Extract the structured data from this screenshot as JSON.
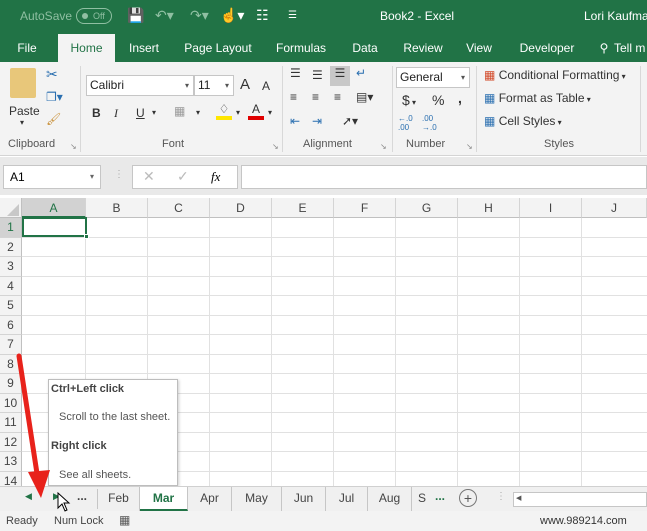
{
  "titlebar": {
    "autosave_label": "AutoSave",
    "autosave_state": "Off",
    "document_title": "Book2  -  Excel",
    "user_name": "Lori Kaufman"
  },
  "ribbon_tabs": [
    "File",
    "Home",
    "Insert",
    "Page Layout",
    "Formulas",
    "Data",
    "Review",
    "View",
    "Developer",
    "Tell m"
  ],
  "active_tab": "Home",
  "ribbon": {
    "clipboard": {
      "label": "Clipboard",
      "paste_label": "Paste"
    },
    "font": {
      "label": "Font",
      "font_name": "Calibri",
      "font_size": "11",
      "bold": "B",
      "italic": "I",
      "underline": "U",
      "grow": "A",
      "shrink": "A",
      "font_color_glyph": "A"
    },
    "alignment": {
      "label": "Alignment"
    },
    "number": {
      "label": "Number",
      "format": "General",
      "currency": "$",
      "percent": "%",
      "comma": ",",
      "inc_decimal": "←.0 .00",
      "dec_decimal": ".00 →.0"
    },
    "styles": {
      "label": "Styles",
      "conditional_formatting": "Conditional Formatting",
      "format_as_table": "Format as Table",
      "cell_styles": "Cell Styles"
    }
  },
  "formula_bar": {
    "name_box": "A1",
    "fx": "fx",
    "value": ""
  },
  "columns": [
    "A",
    "B",
    "C",
    "D",
    "E",
    "F",
    "G",
    "H",
    "I",
    "J"
  ],
  "rows": [
    "1",
    "2",
    "3",
    "4",
    "5",
    "6",
    "7",
    "8",
    "9",
    "10",
    "11",
    "12",
    "13",
    "14"
  ],
  "selected_cell": "A1",
  "tooltip": {
    "heading1": "Ctrl+Left click",
    "body1": "Scroll to the last sheet.",
    "heading2": "Right click",
    "body2": "See all sheets."
  },
  "sheet_tabs": [
    "Feb",
    "Mar",
    "Apr",
    "May",
    "Jun",
    "Jul",
    "Aug",
    "S"
  ],
  "active_sheet": "Mar",
  "sheet_nav": {
    "ellipsis_left": "...",
    "ellipsis_right": "...",
    "add_sheet": "+"
  },
  "statusbar": {
    "ready": "Ready",
    "num_lock": "Num Lock",
    "watermark": "www.989214.com"
  },
  "colors": {
    "excel_green": "#217346",
    "annotation_red": "#e8221b"
  }
}
